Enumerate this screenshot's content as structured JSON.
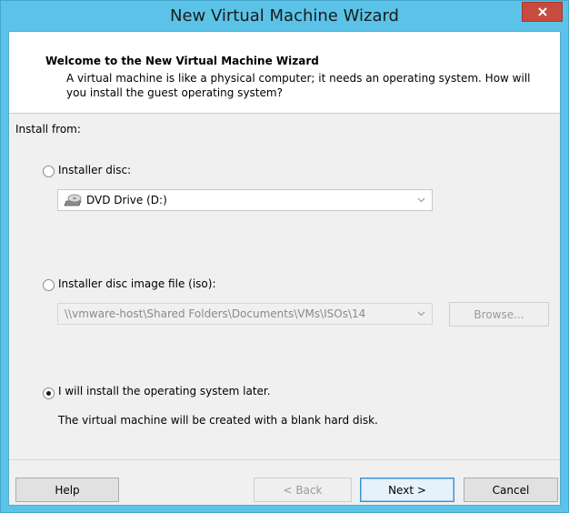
{
  "window": {
    "title": "New Virtual Machine Wizard",
    "close_glyph": "x"
  },
  "header": {
    "title": "Welcome to the New Virtual Machine Wizard",
    "description": "A virtual machine is like a physical computer; it needs an operating system. How will you install the guest operating system?"
  },
  "install": {
    "section_label": "Install from:",
    "options": [
      {
        "label": "Installer disc:",
        "selected": false
      },
      {
        "label": "Installer disc image file (iso):",
        "selected": false
      },
      {
        "label": "I will install the operating system later.",
        "selected": true
      }
    ],
    "disc_drive": {
      "value": "DVD Drive (D:)",
      "icon": "dvd-drive-icon"
    },
    "iso_path": {
      "value": "\\\\vmware-host\\Shared Folders\\Documents\\VMs\\ISOs\\14",
      "enabled": false
    },
    "browse_label": "Browse...",
    "later_note": "The virtual machine will be created with a blank hard disk."
  },
  "footer": {
    "help_label": "Help",
    "back_label": "< Back",
    "next_label": "Next >",
    "cancel_label": "Cancel"
  },
  "colors": {
    "titlebar": "#5bc3e8",
    "close_button": "#c74b3f",
    "dialog_background": "#f0f0f0",
    "primary_button_border": "#3c8fd0"
  }
}
